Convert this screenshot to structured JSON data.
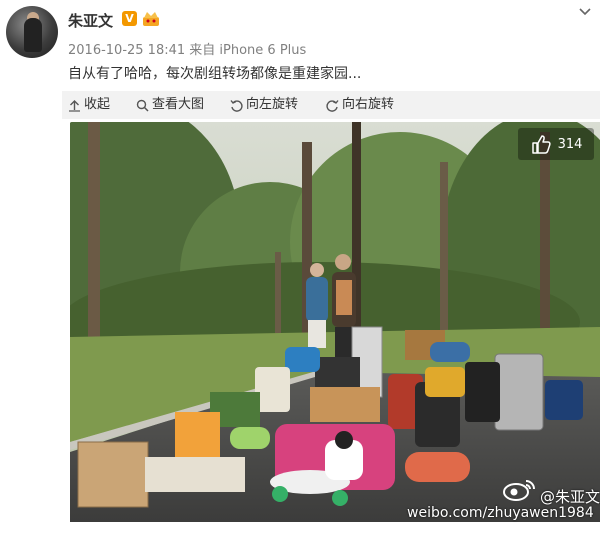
{
  "post": {
    "username": "朱亚文",
    "verified_badge": "V",
    "timestamp": "2016-10-25 18:41 来自 iPhone 6 Plus",
    "text": "自从有了哈哈，每次剧组转场都像是重建家园..."
  },
  "toolbar": {
    "collapse_label": "收起",
    "view_large_label": "查看大图",
    "rotate_left_label": "向左旋转",
    "rotate_right_label": "向右旋转"
  },
  "image": {
    "like_count": "314",
    "watermark_name": "@朱亚文",
    "watermark_url": "weibo.com/zhuyawen1984"
  },
  "icons": {
    "verified": "v-badge-icon",
    "crown": "crown-icon",
    "menu": "chevron-down-icon",
    "collapse": "arrow-up-icon",
    "view_large": "search-icon",
    "rotate_left": "rotate-left-icon",
    "rotate_right": "rotate-right-icon",
    "like": "thumbs-up-icon",
    "watermark": "weibo-eye-logo"
  },
  "colors": {
    "accent_orange": "#f39800",
    "toolbar_bg": "#f2f2f2",
    "meta_gray": "#808080"
  }
}
